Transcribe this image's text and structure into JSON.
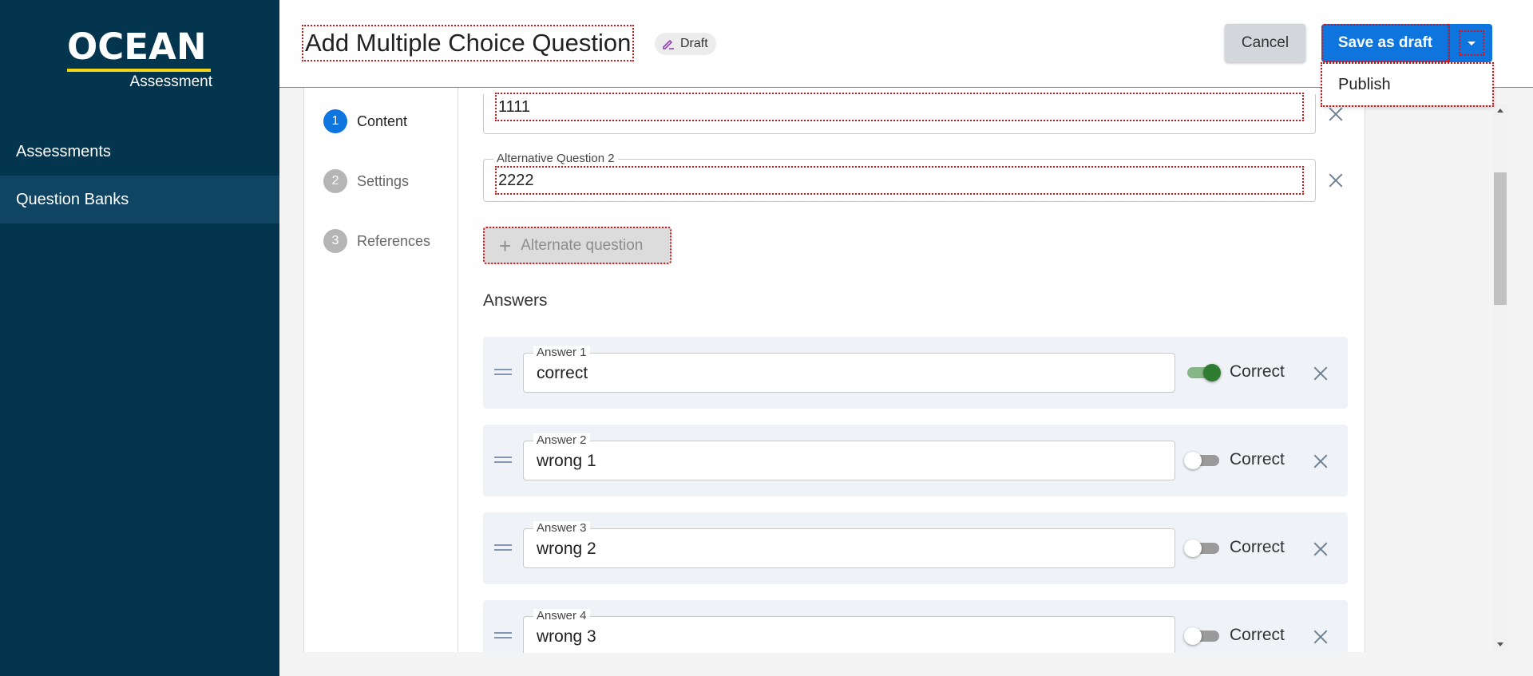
{
  "sidebar": {
    "logo_main": "OCEAN",
    "logo_sub": "Assessment",
    "items": [
      {
        "label": "Assessments"
      },
      {
        "label": "Question Banks",
        "active": true
      }
    ]
  },
  "header": {
    "title": "Add Multiple Choice Question",
    "status_badge": "Draft",
    "cancel_label": "Cancel",
    "save_label": "Save as draft",
    "dropdown_items": [
      "Publish"
    ]
  },
  "stepper": [
    {
      "num": "1",
      "label": "Content",
      "active": true
    },
    {
      "num": "2",
      "label": "Settings"
    },
    {
      "num": "3",
      "label": "References"
    }
  ],
  "alternative_questions": [
    {
      "label": "",
      "value": "1111"
    },
    {
      "label": "Alternative Question 2",
      "value": "2222"
    }
  ],
  "add_alternate_label": "Alternate question",
  "answers_heading": "Answers",
  "answers": [
    {
      "label": "Answer 1",
      "value": "correct",
      "correct": true,
      "correct_label": "Correct"
    },
    {
      "label": "Answer 2",
      "value": "wrong 1",
      "correct": false,
      "correct_label": "Correct"
    },
    {
      "label": "Answer 3",
      "value": "wrong 2",
      "correct": false,
      "correct_label": "Correct"
    },
    {
      "label": "Answer 4",
      "value": "wrong 3",
      "correct": false,
      "correct_label": "Correct"
    }
  ],
  "colors": {
    "sidebar_bg": "#04354f",
    "accent": "#0e74de",
    "toggle_on": "#2e7d32"
  }
}
